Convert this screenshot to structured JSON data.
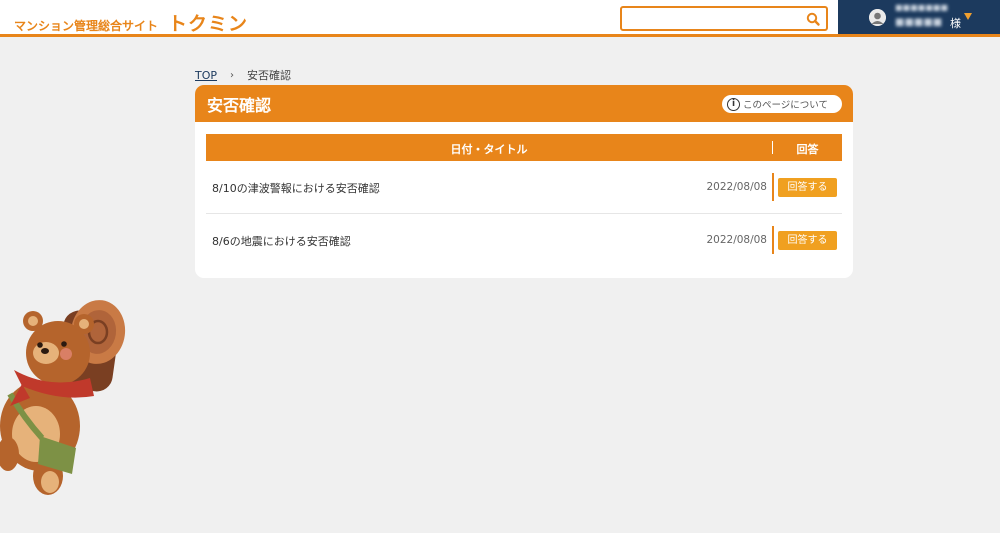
{
  "header": {
    "site_name": "マンション管理総合サイト",
    "brand": "トクミン",
    "search": {
      "value": "",
      "placeholder": ""
    },
    "user": {
      "line1": "■■■■■■■",
      "line2": "■■■■■",
      "honorific": "様"
    }
  },
  "breadcrumb": {
    "home": "TOP",
    "separator": "›",
    "current": "安否確認"
  },
  "card": {
    "title": "安否確認",
    "help_label": "このページについて",
    "help_glyph": "i"
  },
  "table": {
    "headers": {
      "title": "日付・タイトル",
      "answer": "回答"
    },
    "rows": [
      {
        "title": "8/10の津波警報における安否確認",
        "date": "2022/08/08",
        "button": "回答する"
      },
      {
        "title": "8/6の地震における安否確認",
        "date": "2022/08/08",
        "button": "回答する"
      }
    ]
  },
  "colors": {
    "accent": "#e8851a",
    "button": "#f0a020",
    "navy": "#1c3a5e",
    "background": "#f0f0f0"
  },
  "icons": [
    "search-icon",
    "avatar",
    "chevron-down-icon",
    "info-icon",
    "bear-mascot"
  ]
}
